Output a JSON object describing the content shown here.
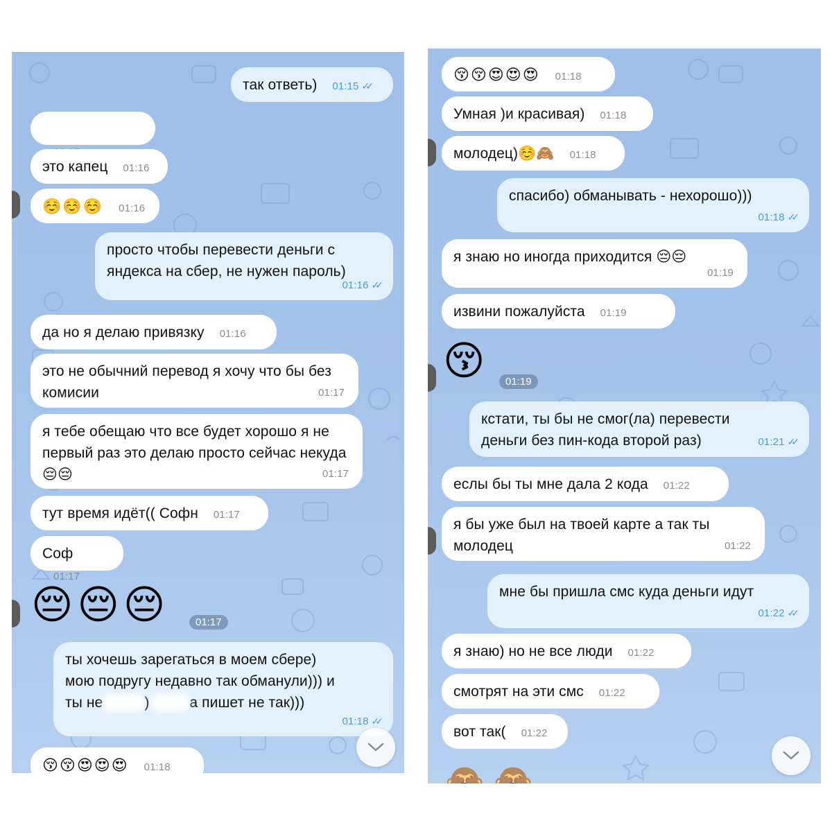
{
  "left": {
    "messages": [
      {
        "id": "l1",
        "dir": "out",
        "text": "так ответь)",
        "time": "01:15",
        "ticks": "✓✓"
      },
      {
        "id": "l2",
        "dir": "in",
        "text": "",
        "time": "01:15"
      },
      {
        "id": "l3",
        "dir": "in",
        "text": "это капец",
        "time": "01:16"
      },
      {
        "id": "l4",
        "dir": "in",
        "text": "☺️☺️☺️",
        "time": "01:16"
      },
      {
        "id": "l5",
        "dir": "out",
        "text": "просто чтобы перевести деньги с яндекса на сбер, не нужен пароль)",
        "time": "01:16",
        "ticks": "✓✓"
      },
      {
        "id": "l6",
        "dir": "in",
        "text": "да но я делаю привязку",
        "time": "01:16"
      },
      {
        "id": "l7",
        "dir": "in",
        "text": "это не обычний перевод я хочу что бы без комисии",
        "time": "01:17"
      },
      {
        "id": "l8",
        "dir": "in",
        "text": "я тебе обещаю что все будет хорошо я не первый раз это делаю просто сейчас некуда 😔😔",
        "time": "01:17"
      },
      {
        "id": "l9",
        "dir": "in",
        "text": "тут время идёт(( Софн",
        "time": "01:17"
      },
      {
        "id": "l10",
        "dir": "in",
        "text": "Соф",
        "time": "01:17"
      },
      {
        "id": "l11",
        "dir": "in",
        "text": "😔😔😔",
        "time": "01:17"
      },
      {
        "id": "l12",
        "dir": "out",
        "line1": "ты хочешь зарегаться в моем сбере)",
        "line2": "мою подругу недавно так обманули))) и",
        "line3a": "ты не",
        "line3b": ")",
        "line3c": "а пишет не так)))",
        "time": "01:18",
        "ticks": "✓✓"
      },
      {
        "id": "l13",
        "dir": "in",
        "text": "😚😚😍😍😍",
        "time": "01:18"
      }
    ]
  },
  "right": {
    "messages": [
      {
        "id": "r1",
        "dir": "in",
        "text": "😚😚😍😍😍",
        "time": "01:18"
      },
      {
        "id": "r2",
        "dir": "in",
        "text": "Умная )и красивая)",
        "time": "01:18"
      },
      {
        "id": "r3",
        "dir": "in",
        "text": "молодец)☺️🙈",
        "time": "01:18"
      },
      {
        "id": "r4",
        "dir": "out",
        "text": "спасибо) обманывать - нехорошо)))",
        "time": "01:18",
        "ticks": "✓✓"
      },
      {
        "id": "r5",
        "dir": "in",
        "text": "я знаю но иногда приходится 😔😔",
        "time": "01:19"
      },
      {
        "id": "r6",
        "dir": "in",
        "text": "извини пожалуйста",
        "time": "01:19"
      },
      {
        "id": "r7",
        "dir": "in",
        "text": "😚",
        "time": "01:19"
      },
      {
        "id": "r8",
        "dir": "out",
        "text": "кстати, ты бы не смог(ла) перевести деньги без пин-кода второй раз)",
        "time": "01:21",
        "ticks": "✓✓"
      },
      {
        "id": "r9",
        "dir": "in",
        "text": "еслы бы ты мне дала 2 кода",
        "time": "01:22"
      },
      {
        "id": "r10",
        "dir": "in",
        "text": "я бы уже был на твоей карте а так ты молодец",
        "time": "01:22"
      },
      {
        "id": "r11",
        "dir": "out",
        "text": "мне бы пришла смс куда деньги идут",
        "time": "01:22",
        "ticks": "✓✓"
      },
      {
        "id": "r12",
        "dir": "in",
        "text": "я знаю) но не все люди",
        "time": "01:22"
      },
      {
        "id": "r13",
        "dir": "in",
        "text": "смотрят на эти смс",
        "time": "01:22"
      },
      {
        "id": "r14",
        "dir": "in",
        "text": "вот так(",
        "time": "01:22"
      },
      {
        "id": "r15",
        "dir": "in",
        "text": "🙈🙈",
        "time": ""
      }
    ]
  },
  "icons": {
    "scroll_down": "chevron-down-icon",
    "read_receipt": "double-check-icon"
  },
  "colors": {
    "incoming": "#ffffff",
    "outgoing": "#e3f1fd",
    "accent": "#4c9ad4",
    "background": "#a4c3ea"
  }
}
